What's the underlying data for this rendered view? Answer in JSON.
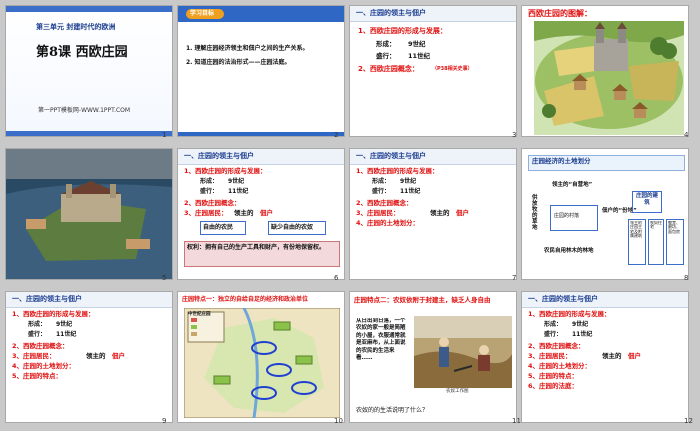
{
  "slides": [
    {
      "num": "1",
      "unit": "第三单元 封建时代的欧洲",
      "title": "第8课 西欧庄园",
      "footer": "第一PPT模板网-WWW.1PPT.COM"
    },
    {
      "num": "2",
      "badge": "学习目标",
      "goal1": "1. 理解庄园经济领主和佃户之间的生产关系。",
      "goal2": "2. 知道庄园的法治形式——庄园法庭。"
    },
    {
      "num": "3",
      "heading": "一、庄园的领主与佃户",
      "item1": "1、西欧庄园的形成与发展：",
      "form_label": "形成：",
      "form_val": "9世纪",
      "pop_label": "盛行：",
      "pop_val": "11世纪",
      "item2": "2、西欧庄园概念：",
      "note": "（P38相关史事）"
    },
    {
      "num": "4",
      "caption": "西欧庄园的图解："
    },
    {
      "num": "5"
    },
    {
      "num": "6",
      "heading": "一、庄园的领主与佃户",
      "item1": "1、西欧庄园的形成与发展：",
      "form_label": "形成：",
      "form_val": "9世纪",
      "pop_label": "盛行：",
      "pop_val": "11世纪",
      "item2": "2、西欧庄园概念：",
      "item3": "3、庄园居民：",
      "lord": "领主的",
      "tenant": "佃户",
      "box1": "自由的农民",
      "box2": "缺少自由的农奴",
      "rights": "权利：拥有自己的生产工具和财产，有份地保留权。"
    },
    {
      "num": "7",
      "heading": "一、庄园的领主与佃户",
      "item1": "1、西欧庄园的形成与发展：",
      "form_label": "形成：",
      "form_val": "9世纪",
      "pop_label": "盛行：",
      "pop_val": "11世纪",
      "item2": "2、西欧庄园概念：",
      "item3": "3、庄园居民：",
      "lord": "领主的",
      "tenant": "佃户",
      "item4": "4、庄园的土地划分："
    },
    {
      "num": "8",
      "title": "庄园经济的土地划分",
      "lord_land": "领主的“自营地”",
      "tenant_land": "佃户的“份地”",
      "common": "供放牧的草地",
      "common2": "农民自用林木的林地",
      "center": "庄园的建筑",
      "house_lbl": "庄园的村落",
      "r1": "领主的庄园主宅及附属建筑",
      "r2": "农奴住宅",
      "r3": "教堂、磨坊、面包房"
    },
    {
      "num": "9",
      "heading": "一、庄园的领主与佃户",
      "item1": "1、西欧庄园的形成与发展：",
      "form_label": "形成：",
      "form_val": "9世纪",
      "pop_label": "盛行：",
      "pop_val": "11世纪",
      "item2": "2、西欧庄园概念：",
      "item3": "3、庄园居民：",
      "lord": "领主的",
      "tenant": "佃户",
      "item4": "4、庄园的土地划分：",
      "item5": "5、庄园的特点："
    },
    {
      "num": "10",
      "title": "庄园特点一：独立的自给自足的经济和政治单位",
      "map_title": "中世纪庄园"
    },
    {
      "num": "11",
      "title": "庄园特点二：农奴依附于封建主，缺乏人身自由",
      "body": "从日出到日落，一个农奴的家一般是简陋的小屋，衣服通常就是亚麻布，从上面说的农民的生活来看……",
      "question": "农奴的的生活说明了什么？",
      "img_cap": "农奴工作图"
    },
    {
      "num": "12",
      "heading": "一、庄园的领主与佃户",
      "item1": "1、西欧庄园的形成与发展：",
      "form_label": "形成：",
      "form_val": "9世纪",
      "pop_label": "盛行：",
      "pop_val": "11世纪",
      "item2": "2、西欧庄园概念：",
      "item3": "3、庄园居民：",
      "lord": "领主的",
      "tenant": "佃户",
      "item4": "4、庄园的土地划分：",
      "item5": "5、庄园的特点：",
      "item6": "6、庄园的法庭："
    }
  ]
}
